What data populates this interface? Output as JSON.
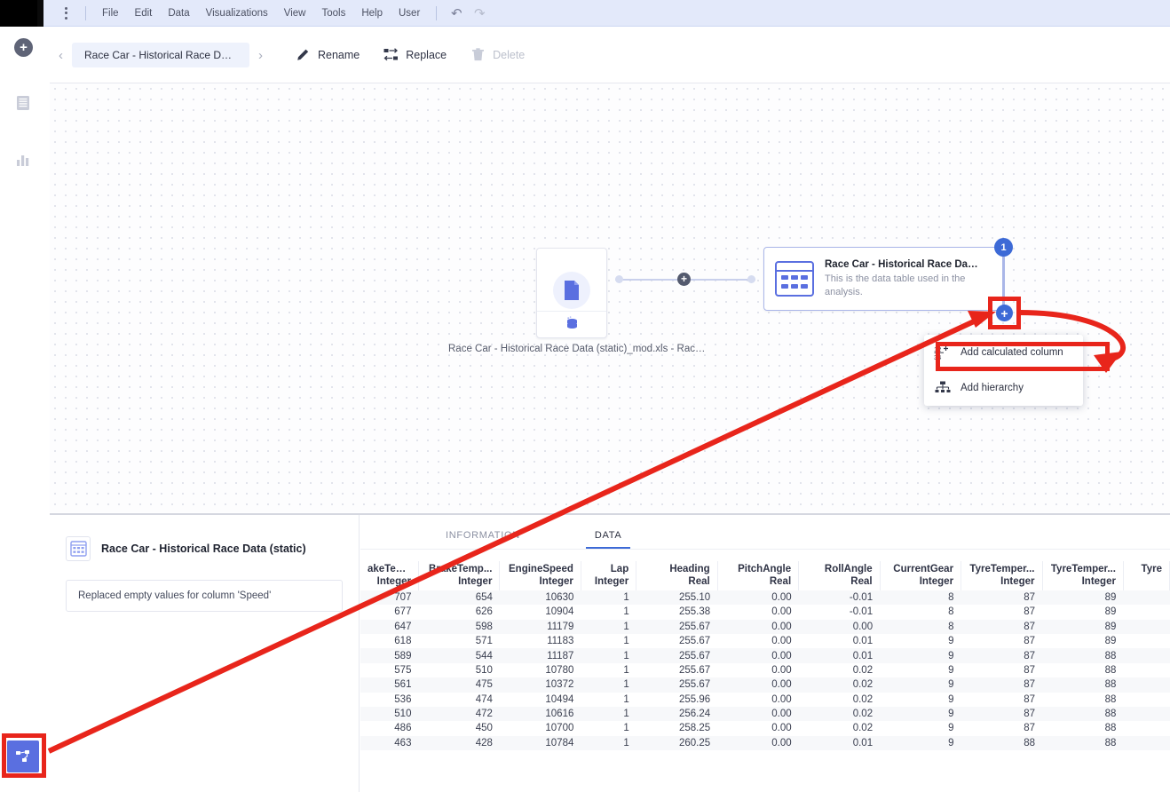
{
  "menubar": {
    "items": [
      "File",
      "Edit",
      "Data",
      "Visualizations",
      "View",
      "Tools",
      "Help",
      "User"
    ],
    "undo_icon": "undo-icon",
    "redo_icon": "redo-icon",
    "kebab_icon": "kebab-menu-icon"
  },
  "toolbar": {
    "prev_label": "‹",
    "next_label": "›",
    "breadcrumb": "Race Car - Historical Race Data (st...",
    "rename_label": "Rename",
    "replace_label": "Replace",
    "delete_label": "Delete"
  },
  "sidebar": {
    "items": [
      {
        "name": "add-icon",
        "label": "+"
      },
      {
        "name": "data-panel-icon",
        "label": ""
      },
      {
        "name": "visualizations-icon",
        "label": ""
      },
      {
        "name": "data-canvas-icon",
        "label": ""
      }
    ]
  },
  "canvas": {
    "file_node": {
      "icon": "file-icon",
      "source_icon": "database-icon",
      "label": "Race Car - Historical Race Data (static)_mod.xls - Race..."
    },
    "connector": {
      "icon": "transformation-plus-icon"
    },
    "table_node": {
      "icon": "data-table-icon",
      "title": "Race Car - Historical Race Data (st...",
      "description": "This is the data table used in the analysis.",
      "badge": "1",
      "add_icon": "plus-icon"
    },
    "context_menu": {
      "items": [
        {
          "icon": "calculated-column-icon",
          "label": "Add calculated column"
        },
        {
          "icon": "hierarchy-icon",
          "label": "Add hierarchy"
        }
      ]
    }
  },
  "bottom_panel": {
    "left": {
      "icon": "data-table-icon",
      "title": "Race Car - Historical Race Data (static)",
      "message": "Replaced empty values for column 'Speed'"
    },
    "tabs": [
      {
        "label": "INFORMATION",
        "active": false
      },
      {
        "label": "DATA",
        "active": true
      }
    ],
    "table": {
      "columns": [
        {
          "name": "akeTemp...",
          "type": "Integer"
        },
        {
          "name": "BrakeTemp...",
          "type": "Integer"
        },
        {
          "name": "EngineSpeed",
          "type": "Integer"
        },
        {
          "name": "Lap",
          "type": "Integer"
        },
        {
          "name": "Heading",
          "type": "Real"
        },
        {
          "name": "PitchAngle",
          "type": "Real"
        },
        {
          "name": "RollAngle",
          "type": "Real"
        },
        {
          "name": "CurrentGear",
          "type": "Integer"
        },
        {
          "name": "TyreTemper...",
          "type": "Integer"
        },
        {
          "name": "TyreTemper...",
          "type": "Integer"
        },
        {
          "name": "Tyre",
          "type": ""
        }
      ],
      "rows": [
        [
          "707",
          "654",
          "10630",
          "1",
          "255.10",
          "0.00",
          "-0.01",
          "8",
          "87",
          "89",
          ""
        ],
        [
          "677",
          "626",
          "10904",
          "1",
          "255.38",
          "0.00",
          "-0.01",
          "8",
          "87",
          "89",
          ""
        ],
        [
          "647",
          "598",
          "11179",
          "1",
          "255.67",
          "0.00",
          "0.00",
          "8",
          "87",
          "89",
          ""
        ],
        [
          "618",
          "571",
          "11183",
          "1",
          "255.67",
          "0.00",
          "0.01",
          "9",
          "87",
          "89",
          ""
        ],
        [
          "589",
          "544",
          "11187",
          "1",
          "255.67",
          "0.00",
          "0.01",
          "9",
          "87",
          "88",
          ""
        ],
        [
          "575",
          "510",
          "10780",
          "1",
          "255.67",
          "0.00",
          "0.02",
          "9",
          "87",
          "88",
          ""
        ],
        [
          "561",
          "475",
          "10372",
          "1",
          "255.67",
          "0.00",
          "0.02",
          "9",
          "87",
          "88",
          ""
        ],
        [
          "536",
          "474",
          "10494",
          "1",
          "255.96",
          "0.00",
          "0.02",
          "9",
          "87",
          "88",
          ""
        ],
        [
          "510",
          "472",
          "10616",
          "1",
          "256.24",
          "0.00",
          "0.02",
          "9",
          "87",
          "88",
          ""
        ],
        [
          "486",
          "450",
          "10700",
          "1",
          "258.25",
          "0.00",
          "0.02",
          "9",
          "87",
          "88",
          ""
        ],
        [
          "463",
          "428",
          "10784",
          "1",
          "260.25",
          "0.00",
          "0.01",
          "9",
          "88",
          "88",
          ""
        ]
      ]
    }
  },
  "annotations": {
    "highlight_color": "#e8251b",
    "accent_color": "#3d6ad6"
  }
}
